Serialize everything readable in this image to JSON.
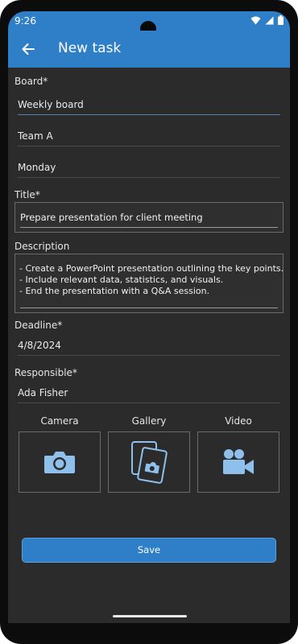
{
  "status": {
    "time": "9:26"
  },
  "appbar": {
    "title": "New task"
  },
  "board": {
    "label": "Board*",
    "board_value": "Weekly board",
    "team_value": "Team A",
    "day_value": "Monday"
  },
  "title_field": {
    "label": "Title*",
    "value": "Prepare presentation for client meeting"
  },
  "description": {
    "label": "Description",
    "lines": [
      "- Create a PowerPoint presentation outlining the key points.",
      "- Include relevant data, statistics, and visuals.",
      "- End the presentation with a Q&A session."
    ]
  },
  "deadline": {
    "label": "Deadline*",
    "value": "4/8/2024"
  },
  "responsible": {
    "label": "Responsible*",
    "value": "Ada Fisher"
  },
  "media": {
    "camera_label": "Camera",
    "gallery_label": "Gallery",
    "video_label": "Video"
  },
  "actions": {
    "save_label": "Save"
  },
  "colors": {
    "accent": "#2f7fc8",
    "icon": "#8fc0ec",
    "background": "#2b2b2b"
  }
}
